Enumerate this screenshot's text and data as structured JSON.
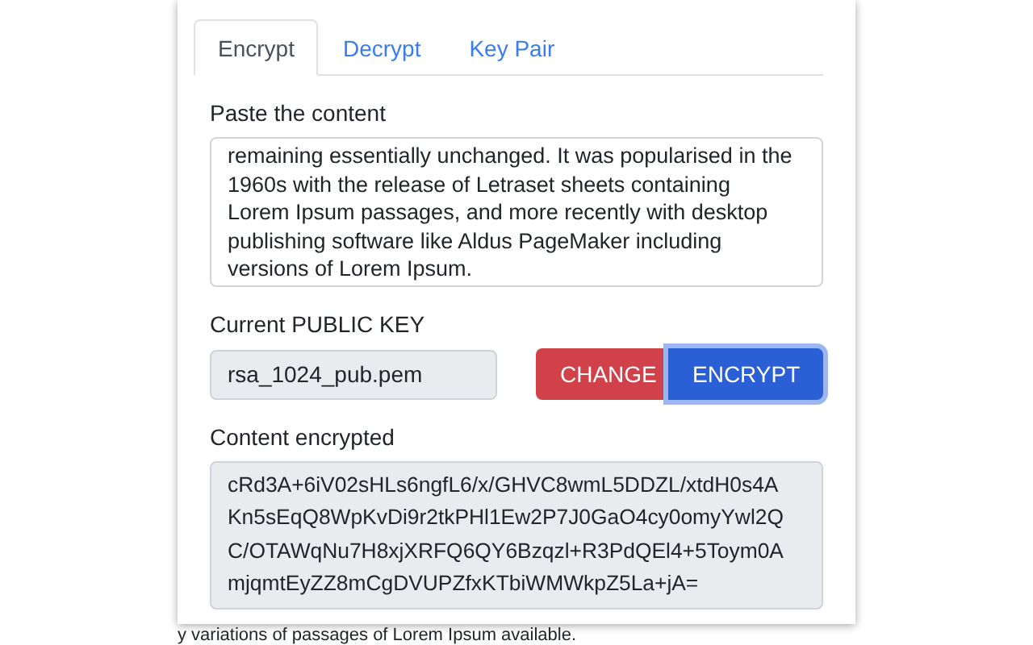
{
  "tabs": [
    {
      "label": "Encrypt",
      "selected": true
    },
    {
      "label": "Decrypt",
      "selected": false
    },
    {
      "label": "Key Pair",
      "selected": false
    }
  ],
  "content": {
    "label": "Paste the content",
    "value": "remaining essentially unchanged. It was popularised in the\n1960s with the release of Letraset sheets containing\nLorem Ipsum passages, and more recently with desktop\npublishing software like Aldus PageMaker including\nversions of Lorem Ipsum."
  },
  "public_key": {
    "label": "Current PUBLIC KEY",
    "value": "rsa_1024_pub.pem"
  },
  "buttons": [
    {
      "label": "CHANGE",
      "kind": "danger"
    },
    {
      "label": "ENCRYPT",
      "kind": "primary"
    }
  ],
  "encrypted": {
    "label": "Content encrypted",
    "value": "cRd3A+6iV02sHLs6ngfL6/x/GHVC8wmL5DDZL/xtdH0s4A\nKn5sEqQ8WpKvDi9r2tkPHl1Ew2P7J0GaO4cy0omyYwl2Q\nC/OTAWqNu7H8xjXRFQ6QY6Bzqzl+R3PdQEl4+5Toym0A\nmjqmtEyZZ8mCgDVUPZfxKTbiWMWkpZ5La+jA="
  },
  "background_text": "y variations of passages of Lorem Ipsum available."
}
